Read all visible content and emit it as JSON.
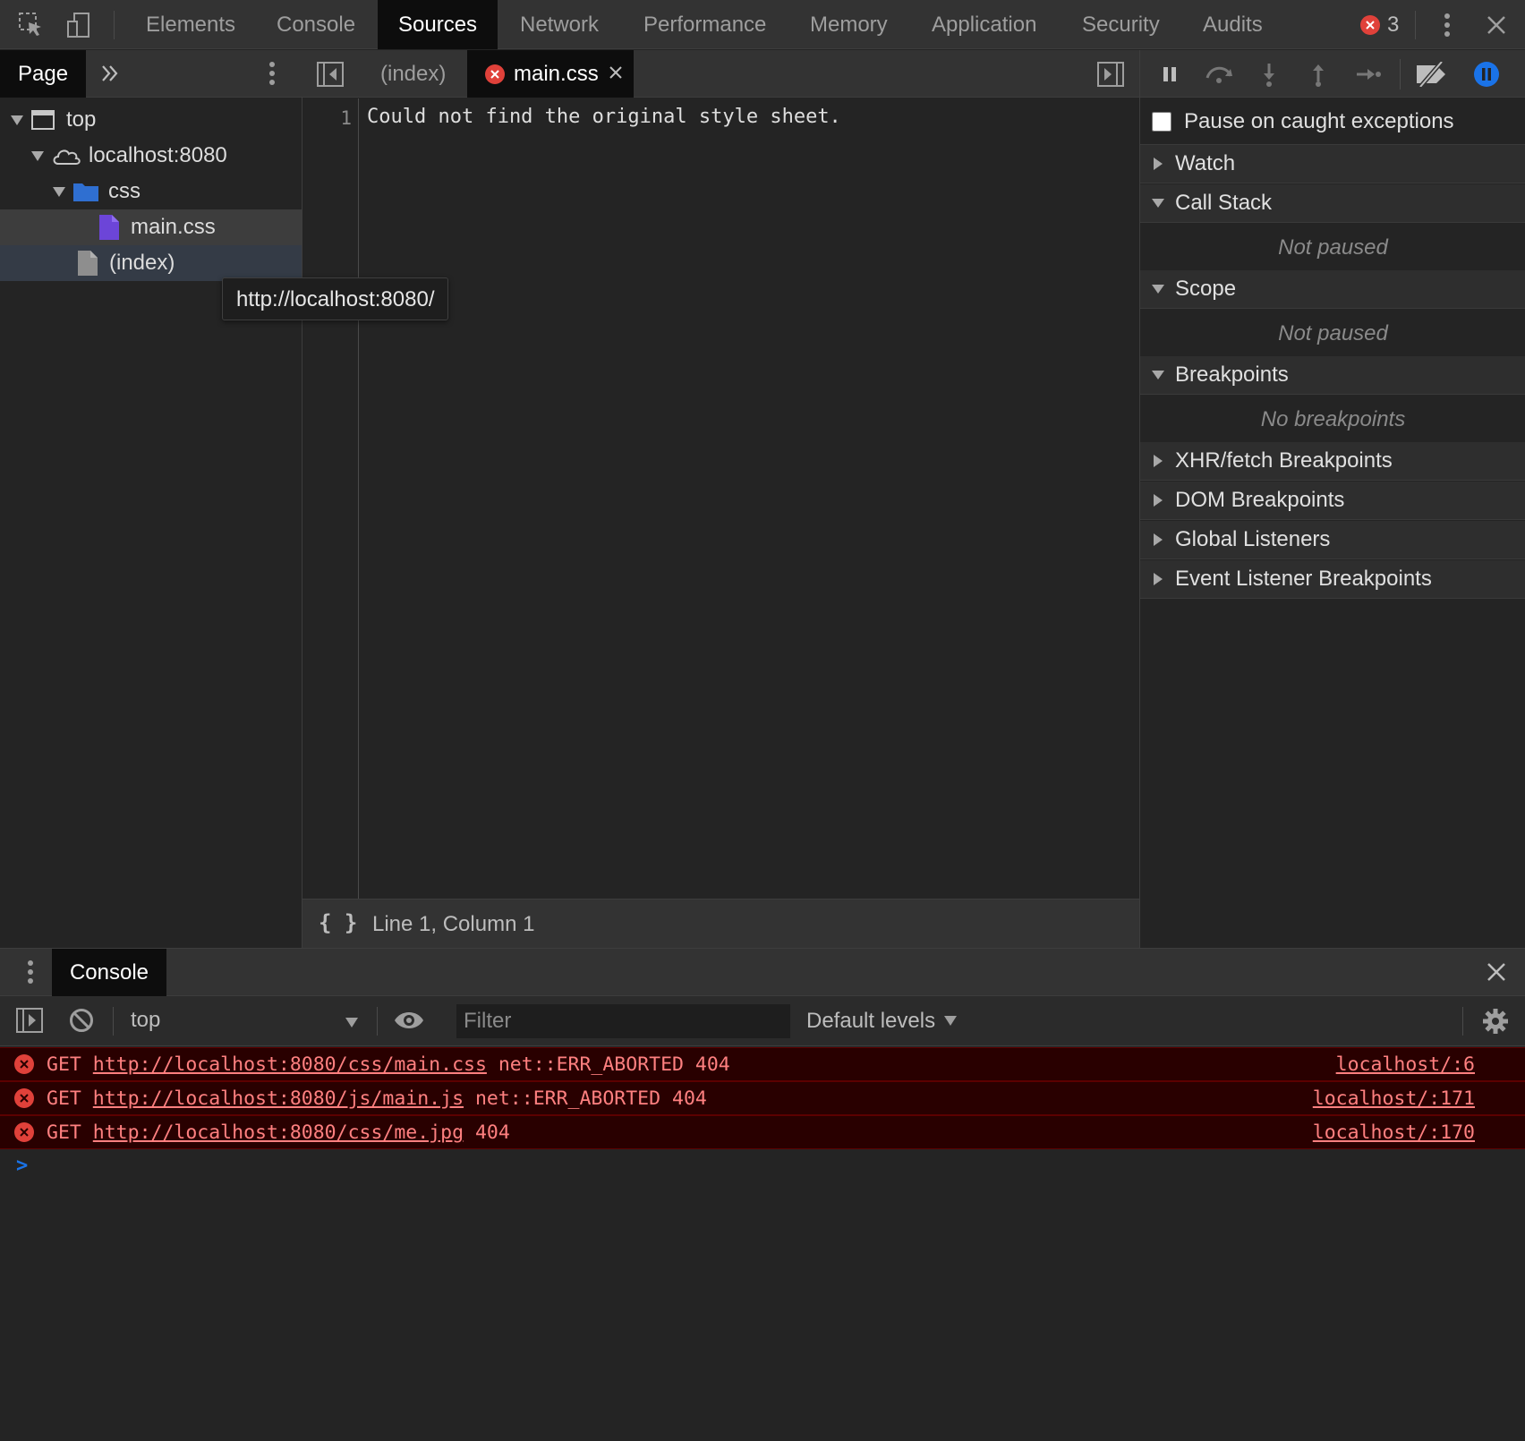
{
  "main_tabs": [
    "Elements",
    "Console",
    "Sources",
    "Network",
    "Performance",
    "Memory",
    "Application",
    "Security",
    "Audits"
  ],
  "active_main_tab": "Sources",
  "error_count": "3",
  "navigator": {
    "tab": "Page",
    "tree": {
      "top": "top",
      "host": "localhost:8080",
      "folder": "css",
      "file_css": "main.css",
      "file_index": "(index)"
    },
    "tooltip": "http://localhost:8080/"
  },
  "editor": {
    "tabs": {
      "index": "(index)",
      "main": "main.css"
    },
    "line_number": "1",
    "code": "Could not find the original style sheet.",
    "status": "Line 1, Column 1",
    "format_icon": "{ }"
  },
  "debugger": {
    "pause_on_caught": "Pause on caught exceptions",
    "sections": {
      "watch": "Watch",
      "call_stack": "Call Stack",
      "call_stack_body": "Not paused",
      "scope": "Scope",
      "scope_body": "Not paused",
      "breakpoints": "Breakpoints",
      "breakpoints_body": "No breakpoints",
      "xhr": "XHR/fetch Breakpoints",
      "dom": "DOM Breakpoints",
      "global": "Global Listeners",
      "event": "Event Listener Breakpoints"
    }
  },
  "drawer": {
    "tab": "Console",
    "context": "top",
    "filter_placeholder": "Filter",
    "levels": "Default levels",
    "messages": [
      {
        "method": "GET",
        "url": "http://localhost:8080/css/main.css",
        "error": "net::ERR_ABORTED 404",
        "source": "localhost/:6"
      },
      {
        "method": "GET",
        "url": "http://localhost:8080/js/main.js",
        "error": "net::ERR_ABORTED 404",
        "source": "localhost/:171"
      },
      {
        "method": "GET",
        "url": "http://localhost:8080/css/me.jpg",
        "error": "404",
        "source": "localhost/:170"
      }
    ],
    "prompt": ">"
  },
  "colors": {
    "error_red": "#e0413a",
    "error_text": "#ff8080",
    "accent_blue": "#1a73e8"
  }
}
